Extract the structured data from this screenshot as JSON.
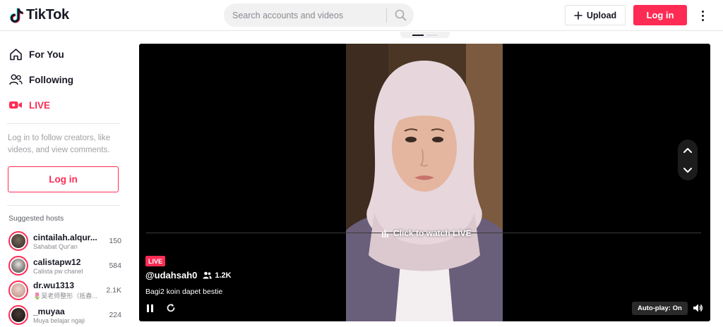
{
  "brand": {
    "name": "TikTok"
  },
  "header": {
    "search_placeholder": "Search accounts and videos",
    "upload_label": "Upload",
    "login_label": "Log in"
  },
  "sidebar": {
    "nav": [
      {
        "label": "For You",
        "icon": "home-icon"
      },
      {
        "label": "Following",
        "icon": "users-icon"
      },
      {
        "label": "LIVE",
        "icon": "live-camera-icon",
        "active": true
      }
    ],
    "hint": "Log in to follow creators, like videos, and view comments.",
    "login_label": "Log in",
    "suggested_title": "Suggested hosts",
    "hosts": [
      {
        "name": "cintailah.alqur...",
        "subtitle": "Sahabat Qur'an",
        "count": "150"
      },
      {
        "name": "calistapw12",
        "subtitle": "Calista pw chanel",
        "count": "584"
      },
      {
        "name": "dr.wu1313",
        "subtitle": "🌷吴老师整形（抵春...",
        "count": "2.1K"
      },
      {
        "name": "_muyaa",
        "subtitle": "Muya belajar ngaji",
        "count": "224"
      }
    ]
  },
  "player": {
    "watch_live": "Click to watch LIVE",
    "live_badge": "LIVE",
    "username": "@udahsah0",
    "viewers": "1.2K",
    "description": "Bagi2 koin dapet bestie",
    "autoplay": "Auto-play: On"
  },
  "colors": {
    "accent": "#fe2c55",
    "text": "#161823",
    "player_bg": "#000000"
  }
}
